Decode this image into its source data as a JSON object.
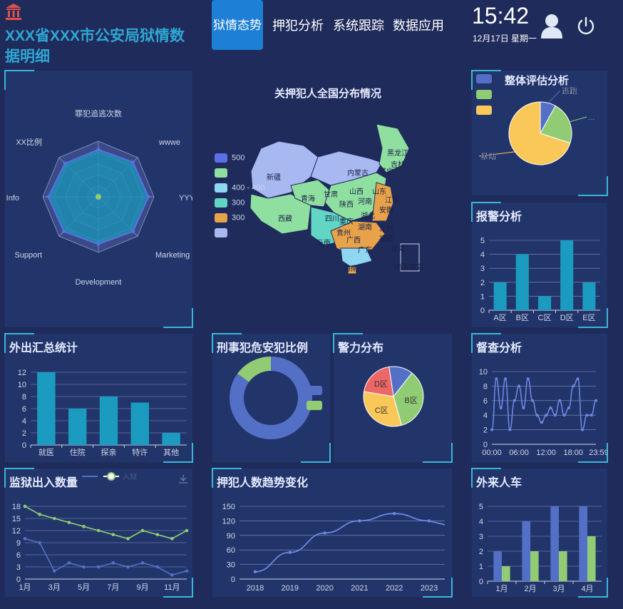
{
  "header": {
    "title": "XXX省XXX市公安局狱情数据明细",
    "nav": [
      "狱情态势",
      "押犯分析",
      "系统跟踪",
      "数据应用"
    ],
    "time": "15:42",
    "date": "12月17日 星期一",
    "colors": {
      "accent": "#1e7fd6",
      "title": "#2fa7d4",
      "logo": "#e1524a"
    }
  },
  "radar": {
    "indicators": [
      "罪犯追逃次数",
      "wwwe",
      "YYY",
      "Marketing",
      "Development",
      "Support",
      "Info",
      "XX比例"
    ]
  },
  "map": {
    "title": "关押犯人全国分布情况",
    "legend_labels": [
      "",
      "",
      "",
      "",
      "",
      ""
    ],
    "legend_values": [
      "500",
      "",
      "400 - 400",
      "300",
      "300",
      ""
    ],
    "legend_colors": [
      "#5b6fe6",
      "#8fe0a0",
      "#8fd7f0",
      "#62d6c4",
      "#e8a24a",
      "#a8b8f0"
    ],
    "region_labels": [
      "黑龙江",
      "吉林",
      "辽宁",
      "内蒙古",
      "新疆",
      "青海",
      "甘肃",
      "山西",
      "山东",
      "河南",
      "陕西",
      "四川",
      "湖北",
      "安徽",
      "江苏",
      "重庆",
      "湖南",
      "江西",
      "贵州",
      "云南",
      "广西",
      "广东",
      "福建",
      "台湾",
      "西藏",
      "南海诸岛",
      "海南"
    ]
  },
  "overall": {
    "title": "整体评估分析",
    "legend": [
      "",
      "",
      ""
    ],
    "legend_colors": [
      "#5470c6",
      "#91cc75",
      "#fac858"
    ],
    "labels": [
      "逃跑",
      "...",
      "暴动"
    ]
  },
  "alarm": {
    "title": "报警分析"
  },
  "outing": {
    "title": "外出汇总统计"
  },
  "criminal": {
    "title": "刑事犯危安犯比例"
  },
  "police": {
    "title": "警力分布"
  },
  "inspect": {
    "title": "督查分析"
  },
  "prison_io": {
    "title": "监狱出入数量",
    "legend": [
      "",
      "入狱"
    ]
  },
  "trend": {
    "title": "押犯人数趋势变化"
  },
  "visitors": {
    "title": "外来人车"
  },
  "chart_data": [
    {
      "type": "radar",
      "indicators": [
        "罪犯追逃次数",
        "wwwe",
        "YYY",
        "Marketing",
        "Development",
        "Support",
        "Info",
        "XX比例"
      ],
      "series": [
        {
          "values": [
            0.85,
            0.88,
            0.9,
            0.88,
            0.85,
            0.88,
            0.9,
            0.85
          ]
        }
      ]
    },
    {
      "type": "pie",
      "title": "整体评估分析",
      "labels": [
        "逃跑",
        "",
        "暴动"
      ],
      "values": [
        8,
        22,
        70
      ]
    },
    {
      "type": "bar",
      "title": "报警分析",
      "categories": [
        "A区",
        "B区",
        "C区",
        "D区",
        "E区"
      ],
      "values": [
        2,
        4,
        1,
        5,
        2
      ],
      "ylim": [
        0,
        5
      ]
    },
    {
      "type": "bar",
      "title": "外出汇总统计",
      "categories": [
        "就医",
        "住院",
        "探亲",
        "特许",
        "其他"
      ],
      "values": [
        12,
        6,
        8,
        7,
        2
      ],
      "ylim": [
        0,
        12
      ]
    },
    {
      "type": "pie",
      "title": "刑事犯危安犯比例",
      "values": [
        85,
        15
      ]
    },
    {
      "type": "pie",
      "title": "警力分布",
      "labels": [
        "D区",
        "B区",
        "C区",
        ""
      ],
      "values": [
        20,
        35,
        32,
        13
      ]
    },
    {
      "type": "line",
      "title": "督查分析",
      "x": [
        "00:00",
        "01:00",
        "02:00",
        "03:00",
        "04:00",
        "05:00",
        "06:00",
        "07:00",
        "08:00",
        "09:00",
        "10:00",
        "11:00",
        "12:00",
        "13:00",
        "14:00",
        "15:00",
        "16:00",
        "17:00",
        "18:00",
        "19:00",
        "20:00",
        "21:00",
        "22:00",
        "23:00"
      ],
      "values": [
        2,
        9,
        5,
        9,
        2,
        6,
        8,
        5,
        9,
        6,
        4,
        3,
        4,
        5,
        4,
        6,
        4,
        5,
        8,
        9,
        2,
        4,
        4,
        6
      ],
      "ylim": [
        0,
        10
      ],
      "xticks": [
        "00:00",
        "06:00",
        "12:00",
        "18:00",
        "23:59"
      ]
    },
    {
      "type": "line",
      "title": "监狱出入数量",
      "categories": [
        "1月",
        "2月",
        "3月",
        "4月",
        "5月",
        "6月",
        "7月",
        "8月",
        "9月",
        "10月",
        "11月",
        "12月"
      ],
      "xticks": [
        "1月",
        "3月",
        "5月",
        "7月",
        "9月",
        "11月"
      ],
      "ylim": [
        0,
        18
      ],
      "series": [
        {
          "name": "",
          "values": [
            10,
            9,
            2,
            4,
            3,
            3,
            4,
            3,
            4,
            3,
            1,
            2
          ]
        },
        {
          "name": "入狱",
          "values": [
            18,
            16,
            15,
            14,
            13,
            12,
            11,
            10,
            12,
            11,
            10,
            12
          ]
        }
      ]
    },
    {
      "type": "line",
      "title": "押犯人数趋势变化",
      "x": [
        "2018",
        "2019",
        "2020",
        "2021",
        "2022",
        "2023"
      ],
      "values": [
        15,
        55,
        95,
        120,
        135,
        120
      ],
      "ylim": [
        0,
        150
      ]
    },
    {
      "type": "bar",
      "title": "外来人车",
      "categories": [
        "1月",
        "2月",
        "3月",
        "4月"
      ],
      "series": [
        {
          "values": [
            2,
            4,
            5,
            5
          ]
        },
        {
          "values": [
            1,
            2,
            2,
            3
          ]
        }
      ],
      "ylim": [
        0,
        5
      ]
    }
  ]
}
